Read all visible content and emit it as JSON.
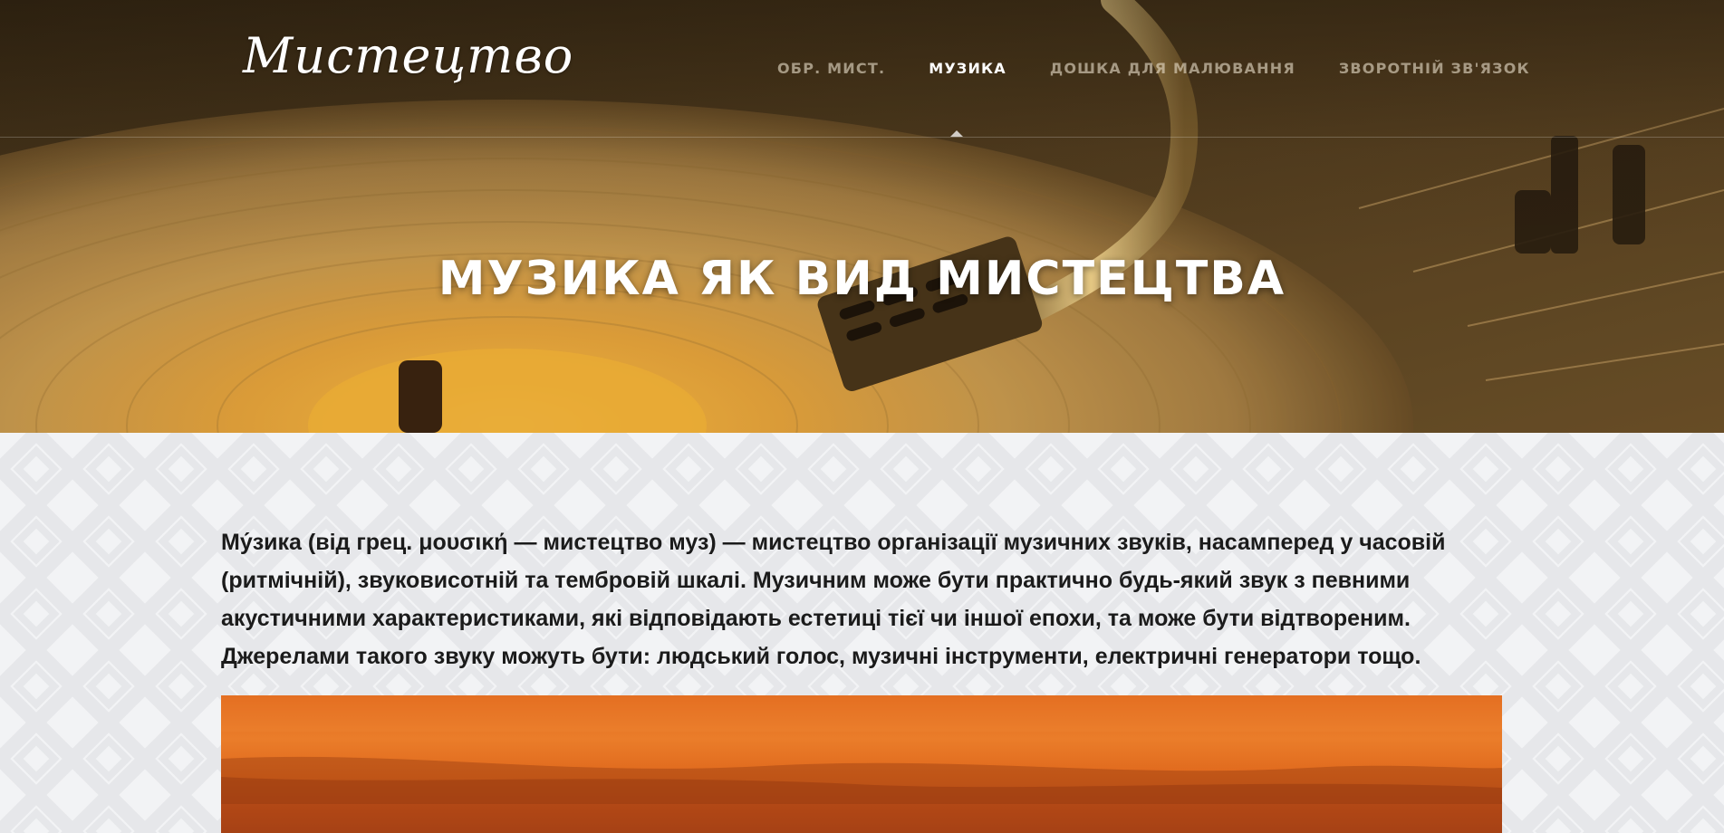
{
  "site": {
    "logo": "Мистецтво"
  },
  "nav": {
    "items": [
      {
        "label": "Обр. мист.",
        "active": false
      },
      {
        "label": "Музика",
        "active": true
      },
      {
        "label": "Дошка для малювання",
        "active": false
      },
      {
        "label": "Зворотній зв'язок",
        "active": false
      }
    ]
  },
  "hero": {
    "title": "МУЗИКА ЯК ВИД МИСТЕЦТВА"
  },
  "article": {
    "paragraph": "Му́зика (від грец. μουσική — мистецтво муз) — мистецтво організації музичних звуків, насамперед у часовій (ритмічній), звуковисотній та тембровій шкалі. Музичним може бути практично будь-який звук з певними акустичними характеристиками, які відповідають естетиці тієї чи іншої епохи, та може бути відтвореним. Джерелами такого звуку можуть бути: людський голос, музичні інструменти, електричні генератори тощо."
  },
  "colors": {
    "hero_gold": "#a57c3c",
    "nav_inactive": "#ebe1cd",
    "text": "#1b1b1b",
    "content_bg": "#f2f3f5",
    "sunset_orange": "#e1661b"
  }
}
